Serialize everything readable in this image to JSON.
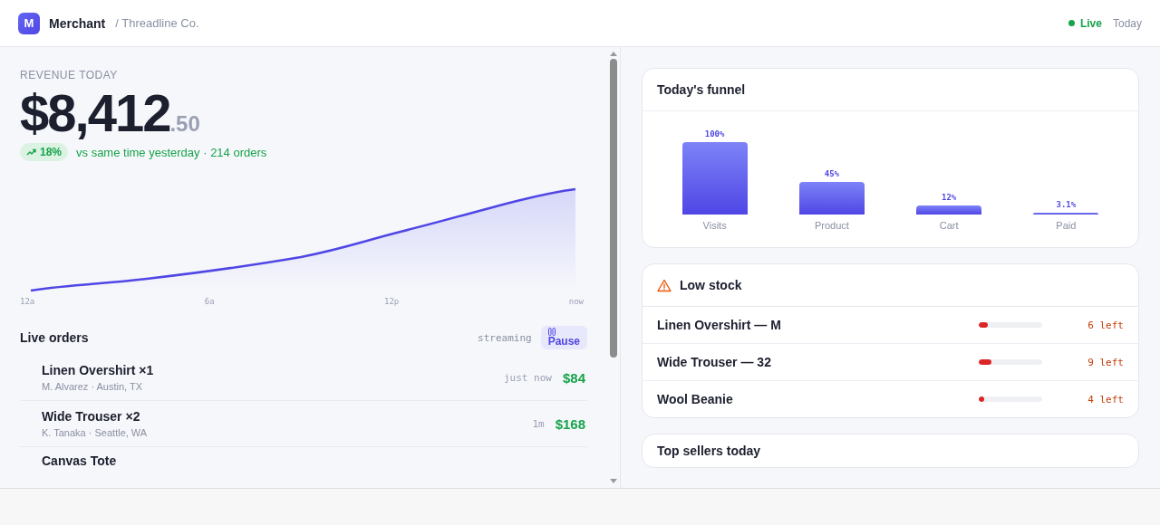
{
  "header": {
    "logo": "M",
    "app": "Merchant",
    "workspace": "/ Threadline Co.",
    "status": "Live",
    "range": "Today"
  },
  "revenue": {
    "label": "REVENUE TODAY",
    "amount": "$8,412",
    "cents": ".50",
    "change": "18%",
    "comparison": "vs same time yesterday · 214 orders",
    "axis": [
      "12a",
      "6a",
      "12p",
      "now"
    ]
  },
  "live_orders": {
    "title": "Live orders",
    "status": "streaming",
    "pause": "Pause",
    "orders": [
      {
        "item": "Linen Overshirt ×1",
        "customer": "M. Alvarez · Austin, TX",
        "time": "just now",
        "total": "$84"
      },
      {
        "item": "Wide Trouser ×2",
        "customer": "K. Tanaka · Seattle, WA",
        "time": "1m",
        "total": "$168"
      },
      {
        "item": "Canvas Tote"
      }
    ]
  },
  "funnel": {
    "title": "Today's funnel",
    "chart_data": {
      "type": "bar",
      "categories": [
        "Visits",
        "Product",
        "Cart",
        "Paid"
      ],
      "values": [
        100,
        45,
        12,
        3.1
      ],
      "data_labels": true,
      "value_labels": [
        "100%",
        "45%",
        "12%",
        "3.1%"
      ]
    }
  },
  "low_stock": {
    "title": "Low stock",
    "items": [
      {
        "name": "Linen Overshirt — M",
        "level": 0.14,
        "remaining": "6 left"
      },
      {
        "name": "Wide Trouser — 32",
        "level": 0.2,
        "remaining": "9 left"
      },
      {
        "name": "Wool Beanie",
        "level": 0.09,
        "remaining": "4 left"
      }
    ]
  },
  "top_sellers": {
    "title": "Top sellers today"
  }
}
